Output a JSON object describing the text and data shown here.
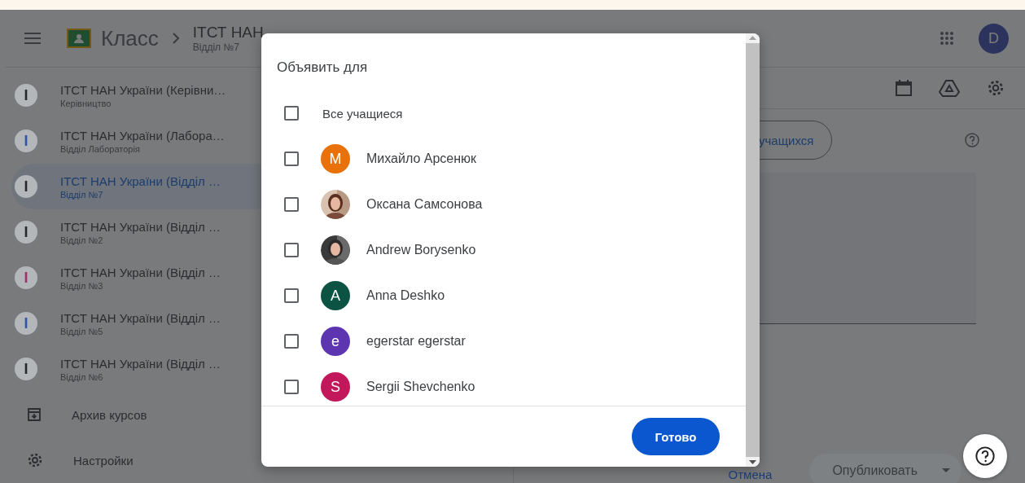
{
  "header": {
    "app_name": "Класс",
    "course_title": "ІТСТ НАН",
    "course_subtitle": "Відділ №7",
    "avatar_letter": "D"
  },
  "sidebar": {
    "courses": [
      {
        "initial": "I",
        "title": "ІТСТ НАН України (Керівни…",
        "subtitle": "Керівництво",
        "color": "#27292c",
        "selected": false
      },
      {
        "initial": "I",
        "title": "ІТСТ НАН України (Лабора…",
        "subtitle": "Відділ Лабораторія",
        "color": "#2f55a8",
        "selected": false
      },
      {
        "initial": "I",
        "title": "ІТСТ НАН України (Відділ …",
        "subtitle": "Відділ №7",
        "color": "#27292c",
        "selected": true
      },
      {
        "initial": "I",
        "title": "ІТСТ НАН України (Відділ …",
        "subtitle": "Відділ №2",
        "color": "#27292c",
        "selected": false
      },
      {
        "initial": "I",
        "title": "ІТСТ НАН України (Відділ …",
        "subtitle": "Відділ №3",
        "color": "#a0306a",
        "selected": false
      },
      {
        "initial": "I",
        "title": "ІТСТ НАН України (Відділ …",
        "subtitle": "Відділ №5",
        "color": "#2f55a8",
        "selected": false
      },
      {
        "initial": "I",
        "title": "ІТСТ НАН України (Відділ …",
        "subtitle": "Відділ №6",
        "color": "#27292c",
        "selected": false
      }
    ],
    "links": [
      {
        "label": "Архив курсов",
        "kind": "archive"
      },
      {
        "label": "Настройки",
        "kind": "settings"
      }
    ]
  },
  "main": {
    "students_button": "учащихся",
    "cancel": "Отмена",
    "publish": {
      "label": "Опубликовать",
      "disabled": true
    }
  },
  "dialog": {
    "title": "Объявить для",
    "all": {
      "label": "Все учащиеся",
      "checked": false
    },
    "students": [
      {
        "name": "Михайло Арсенюк",
        "checked": false,
        "kind": "letter",
        "initial": "M",
        "color": "#e8710a"
      },
      {
        "name": "Оксана Самсонова",
        "checked": false
      },
      {
        "name": "Andrew Borysenko",
        "checked": false
      },
      {
        "name": "Anna Deshko",
        "checked": false,
        "kind": "letter",
        "initial": "A",
        "color": "#0d5344"
      },
      {
        "name": "egerstar egerstar",
        "checked": false,
        "kind": "letter",
        "initial": "e",
        "color": "#5e35b1"
      },
      {
        "name": "Sergii Shevchenko",
        "checked": false,
        "kind": "letter",
        "initial": "S",
        "color": "#c2185b"
      }
    ],
    "done": "Готово"
  }
}
